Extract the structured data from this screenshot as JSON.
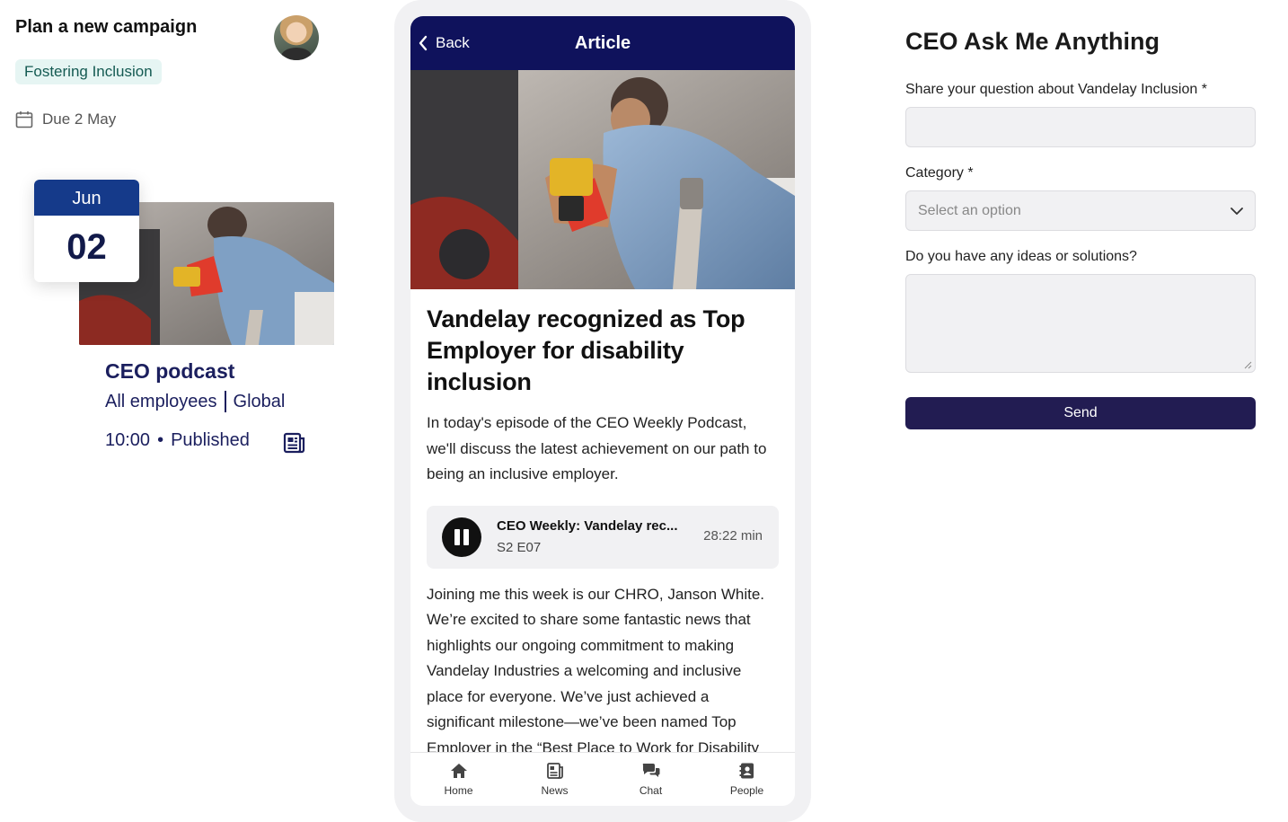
{
  "campaign": {
    "title": "Plan a new campaign",
    "tag": "Fostering Inclusion",
    "due": "Due 2 May"
  },
  "event_card": {
    "month": "Jun",
    "day": "02",
    "title": "CEO podcast",
    "audience": "All employees",
    "region": "Global",
    "time": "10:00",
    "dot": "•",
    "status": "Published"
  },
  "article": {
    "back_label": "Back",
    "header_title": "Article",
    "title": "Vandelay recognized as Top Employer for disability inclusion",
    "lead": "In today's episode of the CEO Weekly Podcast, we'll discuss the latest achievement on our path to being an inclusive employer.",
    "player": {
      "title": "CEO Weekly: Vandelay rec...",
      "episode": "S2 E07",
      "duration": "28:22 min"
    },
    "body": "Joining me this week is our CHRO, Janson White. We’re excited to share some fantastic news that highlights our ongoing commitment to making Vandelay Industries a welcoming and inclusive place for everyone. We’ve just achieved a significant milestone—we’ve been named Top Employer in the “Best Place to Work for Disability Inclusion” category by the"
  },
  "bottom_nav": {
    "items": [
      {
        "label": "Home",
        "icon": "home-icon"
      },
      {
        "label": "News",
        "icon": "news-icon"
      },
      {
        "label": "Chat",
        "icon": "chat-icon"
      },
      {
        "label": "People",
        "icon": "people-icon"
      }
    ]
  },
  "form": {
    "title": "CEO Ask Me Anything",
    "question_label": "Share your question about Vandelay Inclusion *",
    "question_value": "",
    "category_label": "Category *",
    "category_placeholder": "Select an option",
    "ideas_label": "Do you have any ideas or solutions?",
    "ideas_value": "",
    "send_label": "Send"
  },
  "colors": {
    "navy": "#0f125c",
    "badge_blue": "#153a8a",
    "tag_bg": "#e6f5f3",
    "button": "#221c52"
  }
}
